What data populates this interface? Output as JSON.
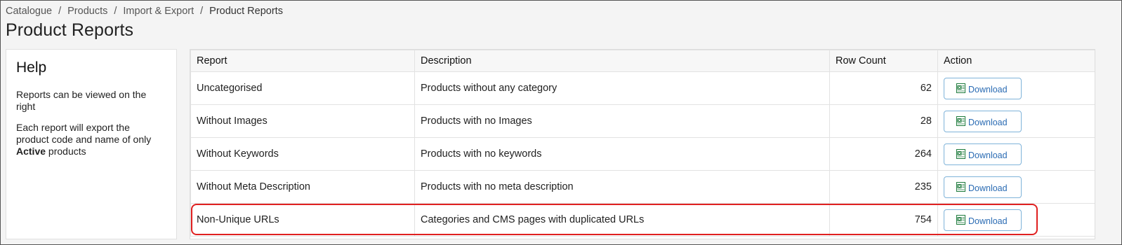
{
  "breadcrumb": {
    "items": [
      "Catalogue",
      "Products",
      "Import & Export",
      "Product Reports"
    ],
    "separator": "/"
  },
  "page": {
    "title": "Product Reports"
  },
  "help": {
    "title": "Help",
    "p1": "Reports can be viewed on the right",
    "p2_before": "Each report will export the product code and name of only ",
    "p2_bold": "Active",
    "p2_after": " products"
  },
  "table": {
    "headers": [
      "Report",
      "Description",
      "Row Count",
      "Action"
    ],
    "rows": [
      {
        "report": "Uncategorised",
        "description": "Products without any category",
        "count": "62",
        "action": "Download"
      },
      {
        "report": "Without Images",
        "description": "Products with no Images",
        "count": "28",
        "action": "Download"
      },
      {
        "report": "Without Keywords",
        "description": "Products with no keywords",
        "count": "264",
        "action": "Download"
      },
      {
        "report": "Without Meta Description",
        "description": "Products with no meta description",
        "count": "235",
        "action": "Download"
      },
      {
        "report": "Non-Unique URLs",
        "description": "Categories and CMS pages with duplicated URLs",
        "count": "754",
        "action": "Download"
      }
    ]
  },
  "icons": {
    "download": "excel-file-icon"
  },
  "colors": {
    "highlight": "#e02020",
    "download_button_border": "#7fb3d9",
    "download_text": "#2a6bb3",
    "excel_green": "#1e7b3c"
  }
}
